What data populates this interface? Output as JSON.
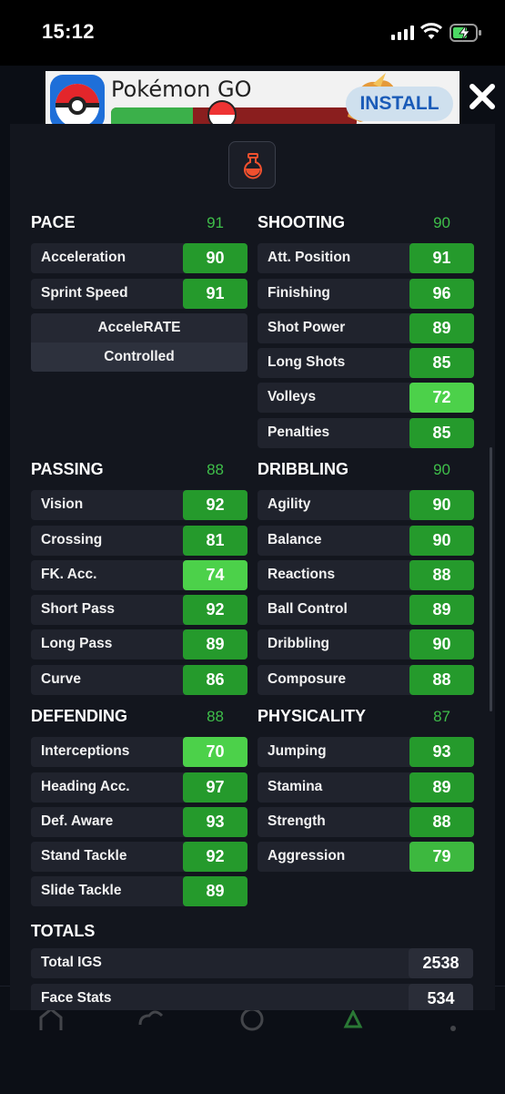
{
  "status_bar": {
    "time": "15:12"
  },
  "ad": {
    "title": "Pokémon GO",
    "install_label": "INSTALL"
  },
  "sheet": {
    "categories": [
      {
        "title": "PACE",
        "value": "91",
        "stats": [
          {
            "name": "Acceleration",
            "value": "90",
            "shade": "dark"
          },
          {
            "name": "Sprint Speed",
            "value": "91",
            "shade": "dark"
          }
        ]
      },
      {
        "title": "SHOOTING",
        "value": "90",
        "stats": [
          {
            "name": "Att. Position",
            "value": "91",
            "shade": "dark"
          },
          {
            "name": "Finishing",
            "value": "96",
            "shade": "dark"
          },
          {
            "name": "Shot Power",
            "value": "89",
            "shade": "dark"
          },
          {
            "name": "Long Shots",
            "value": "85",
            "shade": "dark"
          },
          {
            "name": "Volleys",
            "value": "72",
            "shade": "light"
          },
          {
            "name": "Penalties",
            "value": "85",
            "shade": "dark"
          }
        ]
      },
      {
        "title": "PASSING",
        "value": "88",
        "stats": [
          {
            "name": "Vision",
            "value": "92",
            "shade": "dark"
          },
          {
            "name": "Crossing",
            "value": "81",
            "shade": "dark"
          },
          {
            "name": "FK. Acc.",
            "value": "74",
            "shade": "light"
          },
          {
            "name": "Short Pass",
            "value": "92",
            "shade": "dark"
          },
          {
            "name": "Long Pass",
            "value": "89",
            "shade": "dark"
          },
          {
            "name": "Curve",
            "value": "86",
            "shade": "dark"
          }
        ]
      },
      {
        "title": "DRIBBLING",
        "value": "90",
        "stats": [
          {
            "name": "Agility",
            "value": "90",
            "shade": "dark"
          },
          {
            "name": "Balance",
            "value": "90",
            "shade": "dark"
          },
          {
            "name": "Reactions",
            "value": "88",
            "shade": "dark"
          },
          {
            "name": "Ball Control",
            "value": "89",
            "shade": "dark"
          },
          {
            "name": "Dribbling",
            "value": "90",
            "shade": "dark"
          },
          {
            "name": "Composure",
            "value": "88",
            "shade": "dark"
          }
        ]
      },
      {
        "title": "DEFENDING",
        "value": "88",
        "stats": [
          {
            "name": "Interceptions",
            "value": "70",
            "shade": "light"
          },
          {
            "name": "Heading Acc.",
            "value": "97",
            "shade": "dark"
          },
          {
            "name": "Def. Aware",
            "value": "93",
            "shade": "dark"
          },
          {
            "name": "Stand Tackle",
            "value": "92",
            "shade": "dark"
          },
          {
            "name": "Slide Tackle",
            "value": "89",
            "shade": "dark"
          }
        ]
      },
      {
        "title": "PHYSICALITY",
        "value": "87",
        "stats": [
          {
            "name": "Jumping",
            "value": "93",
            "shade": "dark"
          },
          {
            "name": "Stamina",
            "value": "89",
            "shade": "dark"
          },
          {
            "name": "Strength",
            "value": "88",
            "shade": "dark"
          },
          {
            "name": "Aggression",
            "value": "79",
            "shade": "mid"
          }
        ]
      }
    ],
    "accelerate": {
      "label": "AcceleRATE",
      "value": "Controlled"
    },
    "totals": {
      "title": "TOTALS",
      "rows": [
        {
          "name": "Total IGS",
          "value": "2538"
        },
        {
          "name": "Face Stats",
          "value": "534"
        }
      ]
    }
  },
  "colors": {
    "accent_green": "#3fbf4a",
    "dark_green": "#259a2c",
    "light_green": "#4cd14a",
    "background": "#13161e",
    "icon_red": "#f0502e"
  },
  "icons": {
    "sheet_top": "flask-icon",
    "close": "close-icon"
  }
}
